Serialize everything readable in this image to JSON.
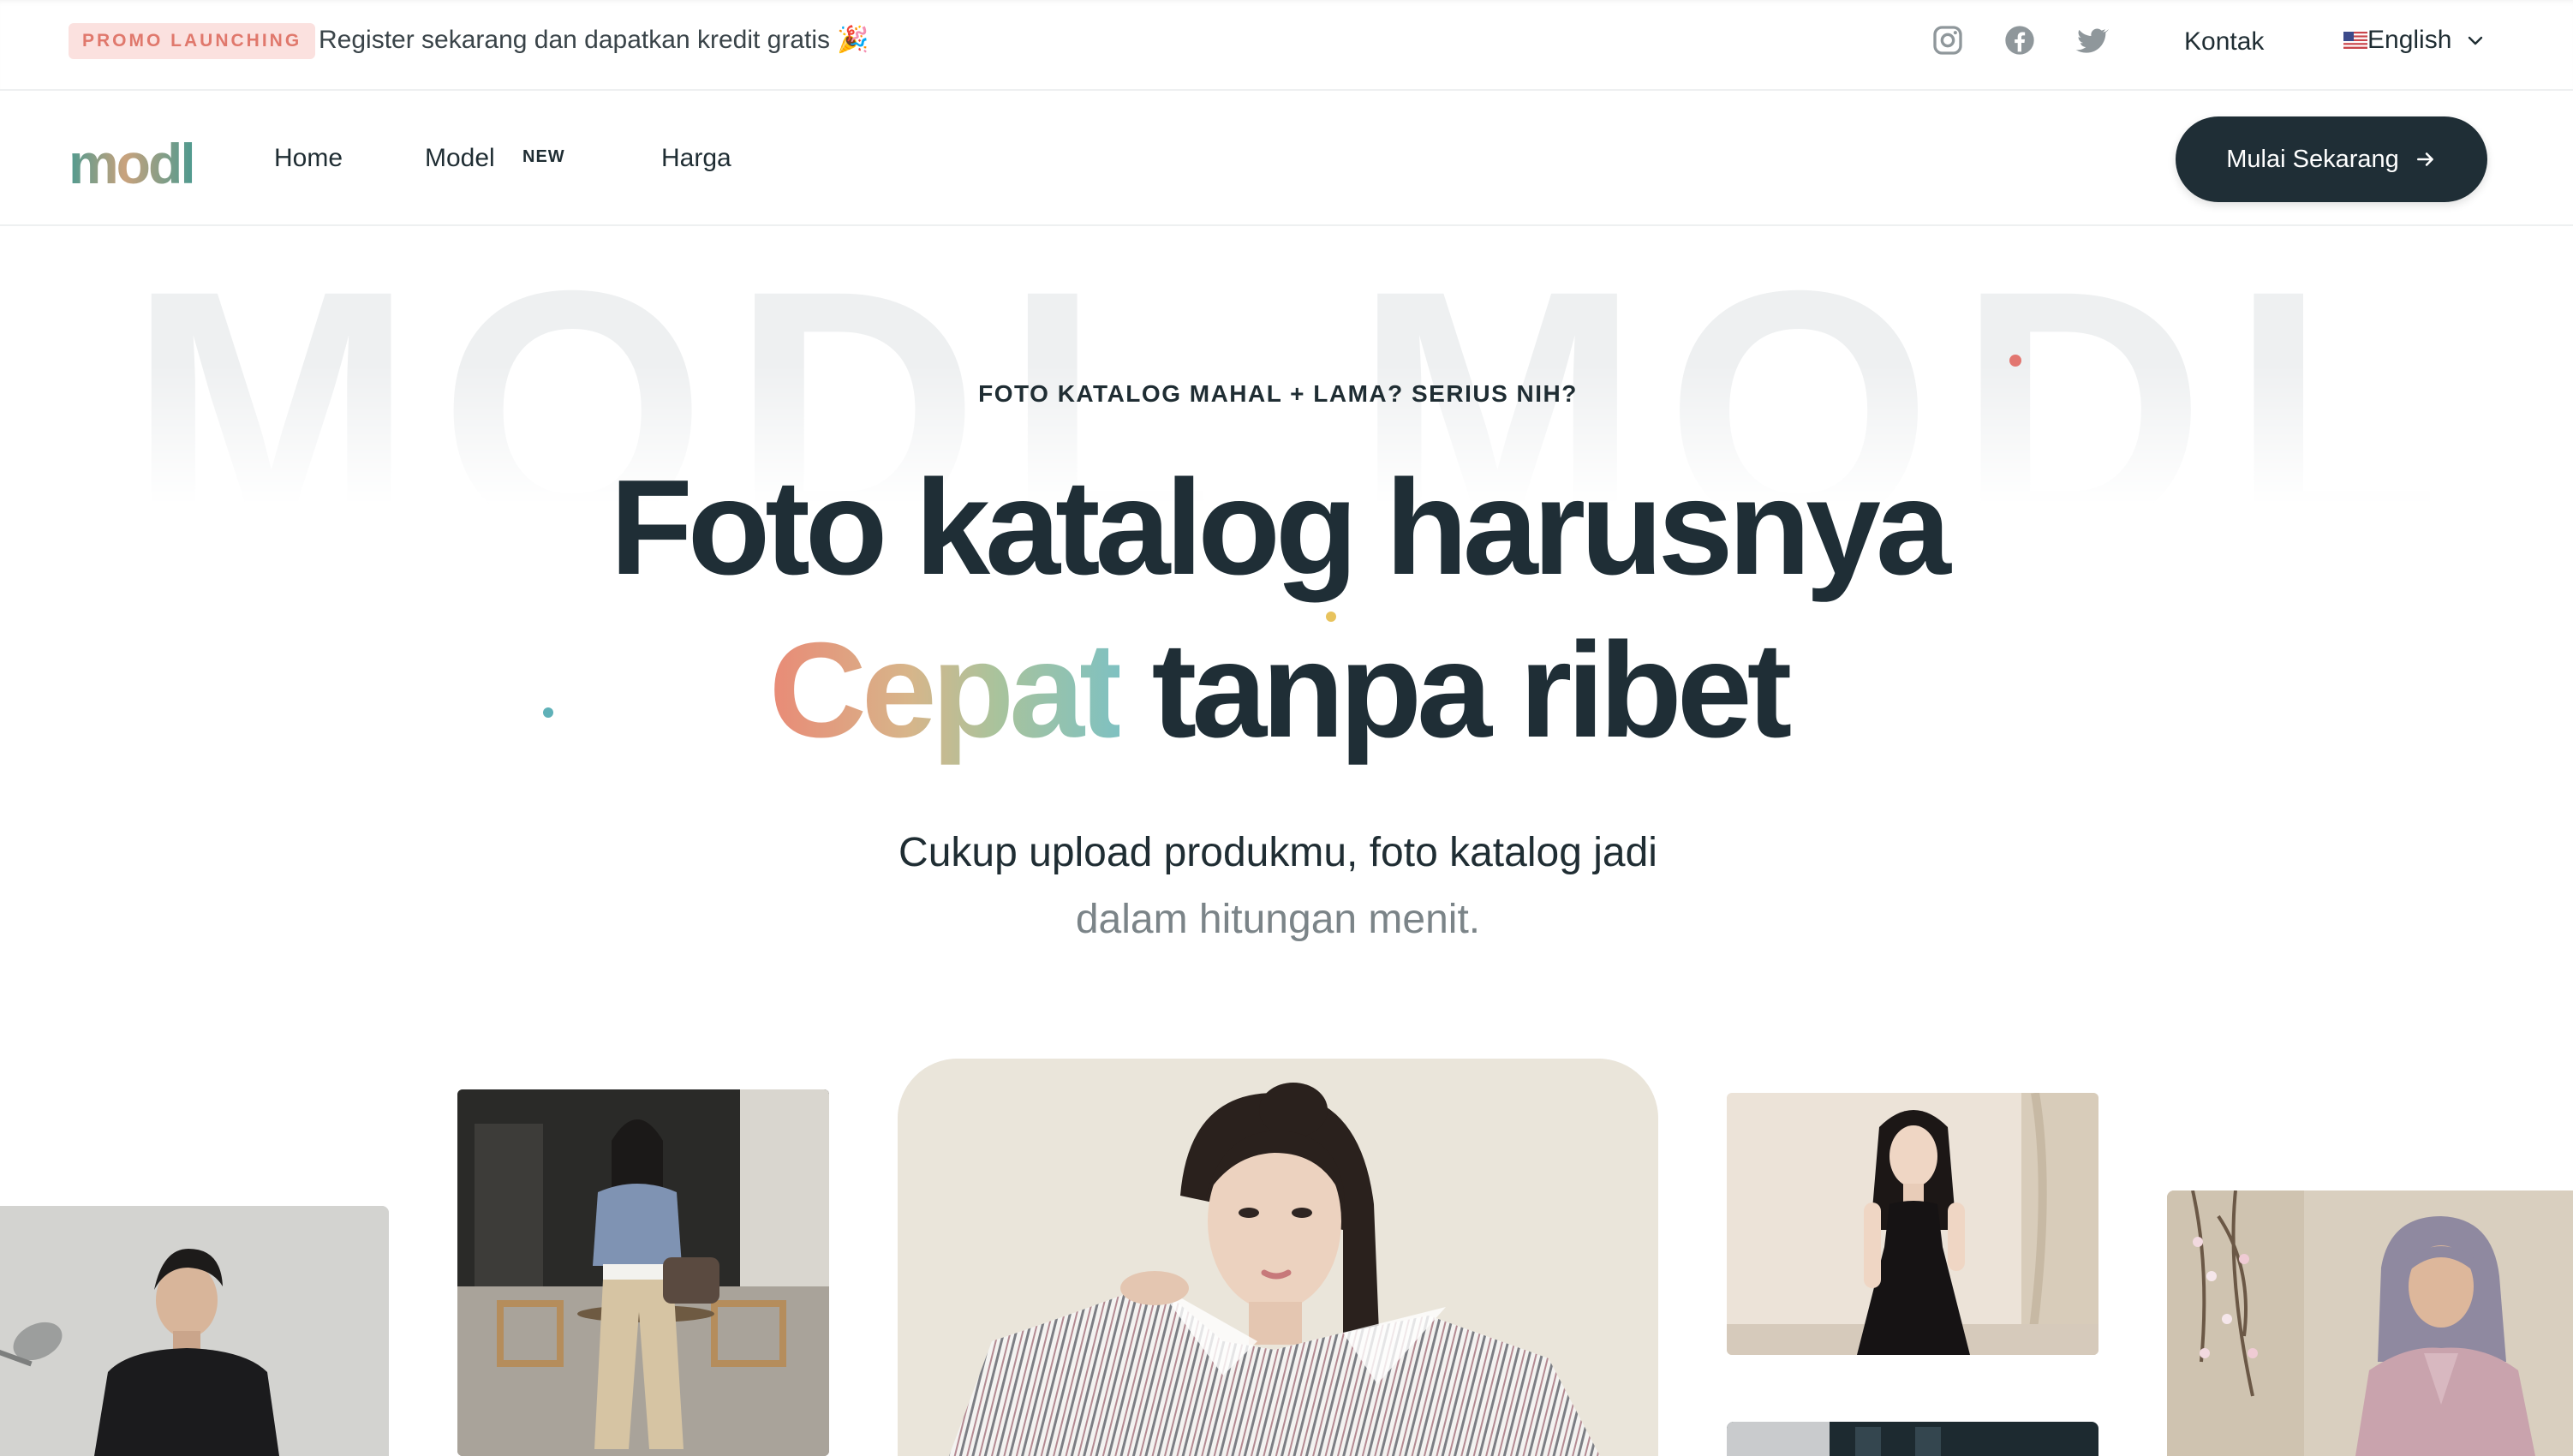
{
  "topbar": {
    "promo_badge": "PROMO LAUNCHING",
    "promo_text": "Register sekarang dan dapatkan kredit gratis 🎉",
    "social": [
      "instagram-icon",
      "facebook-icon",
      "twitter-icon"
    ],
    "contact_label": "Kontak",
    "language_label": "English"
  },
  "nav": {
    "logo_text": "modl",
    "links": [
      "Home",
      "Model",
      "Harga"
    ],
    "new_badge": "NEW",
    "cta_label": "Mulai Sekarang"
  },
  "hero": {
    "watermark": "MODL MODL",
    "eyebrow": "FOTO KATALOG MAHAL + LAMA? SERIUS NIH?",
    "headline_line1": "Foto katalog harusnya",
    "headline_accent": "Cepat",
    "headline_line2_rest": " tanpa ribet",
    "subtitle_line1": "Cukup upload produkmu, foto katalog jadi",
    "subtitle_line2": "dalam hitungan menit."
  },
  "colors": {
    "brand_dark": "#1f2e36",
    "promo_bg": "#fbe1df",
    "promo_text": "#e0786c",
    "gradient": [
      "#e98a76",
      "#d7b58a",
      "#a9c39c",
      "#7fc1c1"
    ]
  }
}
